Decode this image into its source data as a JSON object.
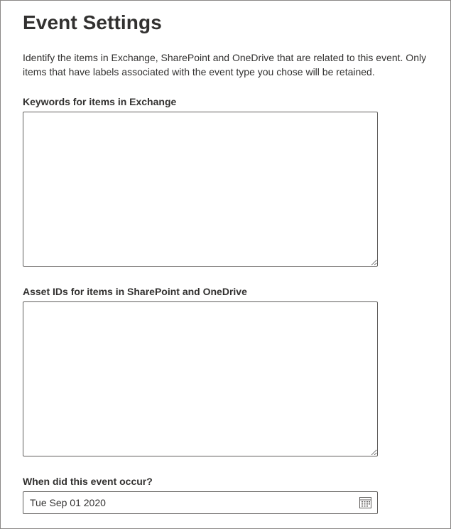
{
  "page": {
    "title": "Event Settings",
    "description": "Identify the items in Exchange, SharePoint and OneDrive that are related to this event. Only items that have labels associated with the event type you chose will be retained."
  },
  "fields": {
    "keywords": {
      "label": "Keywords for items in Exchange",
      "value": ""
    },
    "asset_ids": {
      "label": "Asset IDs for items in SharePoint and OneDrive",
      "value": ""
    },
    "event_date": {
      "label": "When did this event occur?",
      "value": "Tue Sep 01 2020",
      "icon": "calendar-icon"
    }
  }
}
